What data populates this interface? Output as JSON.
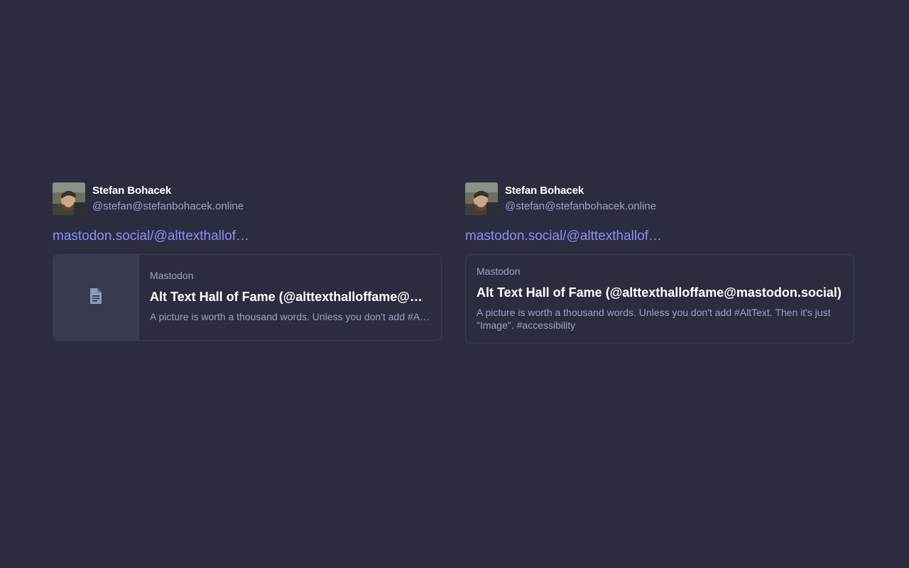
{
  "posts": [
    {
      "author": {
        "display_name": "Stefan Bohacek",
        "handle": "@stefan@stefanbohacek.online"
      },
      "link_text": "mastodon.social/@alttexthallof…",
      "card": {
        "provider": "Mastodon",
        "title": "Alt Text Hall of Fame (@alttexthalloffame@mastodon.social)",
        "description": "A picture is worth a thousand words. Unless you don't add #AltText. Then it's just \"Image\". #accessibility",
        "thumbnail_icon": "document-icon"
      }
    },
    {
      "author": {
        "display_name": "Stefan Bohacek",
        "handle": "@stefan@stefanbohacek.online"
      },
      "link_text": "mastodon.social/@alttexthallof…",
      "card": {
        "provider": "Mastodon",
        "title": "Alt Text Hall of Fame (@alttexthalloffame@mastodon.social)",
        "description": "A picture is worth a thousand words. Unless you don't add #AltText. Then it's just \"Image\". #accessibility"
      }
    }
  ],
  "colors": {
    "background": "#2b2d3f",
    "link": "#8c8dff",
    "secondary_text": "#9ba3c6",
    "card_border": "#3b3e54",
    "thumb_background": "#383b4e"
  }
}
